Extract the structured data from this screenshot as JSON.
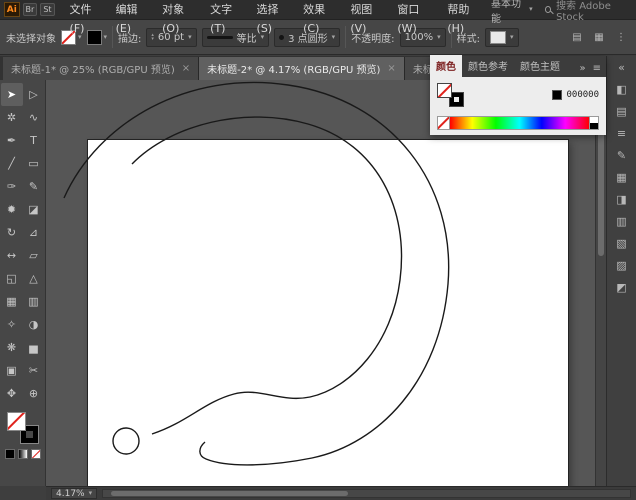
{
  "app": {
    "logo": "Ai",
    "badges": [
      "Br",
      "St"
    ],
    "workspace": "基本功能",
    "search_text": "搜索 Adobe Stock"
  },
  "menubar": {
    "items": [
      "文件(F)",
      "编辑(E)",
      "对象(O)",
      "文字(T)",
      "选择(S)",
      "效果(C)",
      "视图(V)",
      "窗口(W)",
      "帮助(H)"
    ]
  },
  "controls": {
    "selection_status": "未选择对象",
    "stroke_label": "描边:",
    "stroke_value": "60 pt",
    "profile_value": "等比",
    "brush_value": "3 点圆形",
    "opacity_label": "不透明度:",
    "opacity_value": "100%",
    "style_label": "样式:",
    "caret": "▾",
    "stepper_up": "▴",
    "stepper_down": "▾"
  },
  "tabs": {
    "items": [
      {
        "label": "未标题-1* @ 25% (RGB/GPU 预览)",
        "close": "×"
      },
      {
        "label": "未标题-2* @ 4.17% (RGB/GPU 预览)",
        "close": "×"
      },
      {
        "label": "未标...",
        "close": ""
      }
    ]
  },
  "color_panel": {
    "tabs": [
      "颜色",
      "颜色参考",
      "颜色主题"
    ],
    "overflow": "»",
    "menu": "≡",
    "hex": "000000",
    "hex_color": "#000000"
  },
  "tools": {
    "items": [
      {
        "name": "selection",
        "glyph": "➤"
      },
      {
        "name": "direct-selection",
        "glyph": "▷"
      },
      {
        "name": "magic-wand",
        "glyph": "✲"
      },
      {
        "name": "lasso",
        "glyph": "∿"
      },
      {
        "name": "pen",
        "glyph": "✒"
      },
      {
        "name": "type",
        "glyph": "T"
      },
      {
        "name": "line-segment",
        "glyph": "╱"
      },
      {
        "name": "rectangle",
        "glyph": "▭"
      },
      {
        "name": "paintbrush",
        "glyph": "✑"
      },
      {
        "name": "pencil",
        "glyph": "✎"
      },
      {
        "name": "blob-brush",
        "glyph": "✹"
      },
      {
        "name": "eraser",
        "glyph": "◪"
      },
      {
        "name": "rotate",
        "glyph": "↻"
      },
      {
        "name": "scale",
        "glyph": "⊿"
      },
      {
        "name": "width",
        "glyph": "↔"
      },
      {
        "name": "free-transform",
        "glyph": "▱"
      },
      {
        "name": "shape-builder",
        "glyph": "◱"
      },
      {
        "name": "perspective-grid",
        "glyph": "△"
      },
      {
        "name": "mesh",
        "glyph": "▦"
      },
      {
        "name": "gradient",
        "glyph": "▥"
      },
      {
        "name": "eyedropper",
        "glyph": "✧"
      },
      {
        "name": "blend",
        "glyph": "◑"
      },
      {
        "name": "symbol-sprayer",
        "glyph": "❋"
      },
      {
        "name": "column-graph",
        "glyph": "▅"
      },
      {
        "name": "artboard",
        "glyph": "▣"
      },
      {
        "name": "slice",
        "glyph": "✂"
      },
      {
        "name": "hand",
        "glyph": "✥"
      },
      {
        "name": "zoom",
        "glyph": "⊕"
      }
    ]
  },
  "dock": {
    "icons": [
      "«",
      "◧",
      "▤",
      "≡",
      "✎",
      "▦",
      "◨",
      "▥",
      "▧",
      "▨",
      "◩"
    ]
  },
  "canvas": {
    "paths": [
      "M 18 118 C 52 42 142 -10 242 5 C 346 20 410 104 402 204 C 394 300 334 364 266 378 C 226 386 182 388 160 379 C 152 376 152 368 159 362",
      "M 86 84 C 125 44 200 26 262 44 C 332 64 363 130 354 200 C 346 264 305 308 264 317 C 235 323 214 307 188 314 C 158 322 142 342 106 354",
      "M 67 361 A 13 13 0 1 0 93 361 A 13 13 0 1 0 67 361"
    ]
  },
  "statusbar": {
    "zoom": "4.17%",
    "caret": "▾"
  }
}
